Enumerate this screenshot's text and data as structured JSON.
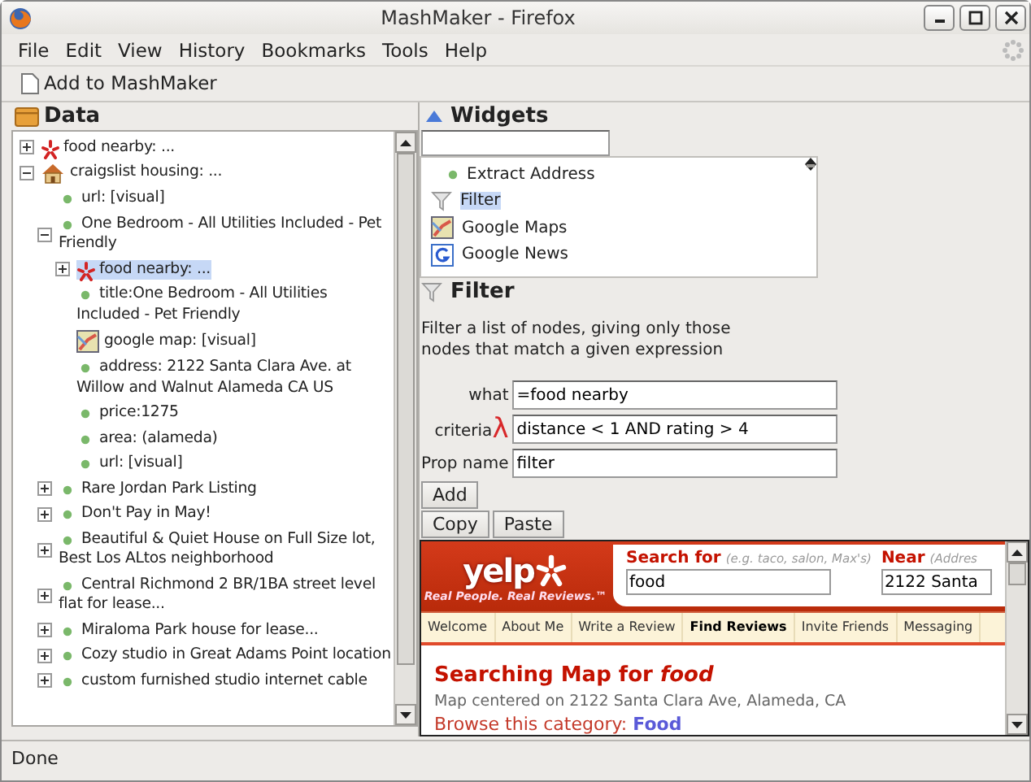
{
  "window": {
    "title": "MashMaker - Firefox"
  },
  "menu": [
    {
      "label": "File"
    },
    {
      "label": "Edit"
    },
    {
      "label": "View"
    },
    {
      "label": "History"
    },
    {
      "label": "Bookmarks"
    },
    {
      "label": "Tools"
    },
    {
      "label": "Help"
    }
  ],
  "toolbar": {
    "button": "Add to MashMaker"
  },
  "data_panel": {
    "title": "Data",
    "tree": [
      {
        "kind": "yelp",
        "label": "food nearby: ...",
        "expanded": false,
        "selected": false
      },
      {
        "kind": "house",
        "label": "craigslist housing: ...",
        "expanded": true,
        "selected": false,
        "children": [
          {
            "kind": "dot",
            "label": "url: [visual]",
            "selected": false
          },
          {
            "kind": "dot",
            "label": "One Bedroom - All Utilities Included - Pet Friendly",
            "expanded": true,
            "selected": false,
            "children": [
              {
                "kind": "yelp",
                "label": "food nearby: ...",
                "expanded": false,
                "selected": true
              },
              {
                "kind": "dot",
                "label": "title:One Bedroom - All Utilities Included - Pet Friendly",
                "selected": false
              },
              {
                "kind": "map",
                "label": "google map: [visual]",
                "selected": false
              },
              {
                "kind": "dot",
                "label": "address: 2122 Santa Clara Ave. at Willow and Walnut Alameda CA US",
                "selected": false
              },
              {
                "kind": "dot",
                "label": "price:1275",
                "selected": false
              },
              {
                "kind": "dot",
                "label": "area: (alameda)",
                "selected": false
              },
              {
                "kind": "dot",
                "label": "url: [visual]",
                "selected": false
              }
            ]
          },
          {
            "kind": "dot",
            "label": "Rare Jordan Park Listing",
            "expanded": false,
            "selected": false
          },
          {
            "kind": "dot",
            "label": "Don't Pay in May!",
            "expanded": false,
            "selected": false
          },
          {
            "kind": "dot",
            "label": "Beautiful & Quiet House on Full Size lot, Best Los ALtos neighborhood",
            "expanded": false,
            "selected": false
          },
          {
            "kind": "dot",
            "label": "Central Richmond 2 BR/1BA street level flat for lease...",
            "expanded": false,
            "selected": false
          },
          {
            "kind": "dot",
            "label": "Miraloma Park house for lease...",
            "expanded": false,
            "selected": false
          },
          {
            "kind": "dot",
            "label": "Cozy studio in Great Adams Point location",
            "expanded": false,
            "selected": false
          },
          {
            "kind": "dot",
            "label": "custom furnished studio internet cable",
            "expanded": false,
            "selected": false
          }
        ]
      }
    ]
  },
  "widgets_panel": {
    "title": "Widgets",
    "items": [
      {
        "kind": "dot",
        "label": "Extract Address",
        "selected": false
      },
      {
        "kind": "funnel",
        "label": "Filter",
        "selected": true
      },
      {
        "kind": "map",
        "label": "Google Maps",
        "selected": false
      },
      {
        "kind": "news",
        "label": "Google News",
        "selected": false
      }
    ]
  },
  "filter": {
    "title": "Filter",
    "description": "Filter a list of nodes, giving only those nodes that match a given expression",
    "fields": [
      {
        "label": "what",
        "value": "=food nearby"
      },
      {
        "label": "criteria",
        "icon_char": "λ",
        "value": "distance < 1 AND rating > 4"
      },
      {
        "label": "Prop name",
        "value": "filter"
      }
    ],
    "buttons": [
      "Add"
    ],
    "clipboard_buttons": [
      "Copy",
      "Paste"
    ]
  },
  "web_frame": {
    "logo": "yelp",
    "tagline": "Real People. Real Reviews.™",
    "search_label": "Search for",
    "search_hint": "(e.g. taco, salon, Max's)",
    "search_value": "food",
    "near_label": "Near",
    "near_hint": "(Addres",
    "near_value": "2122 Santa",
    "nav": [
      {
        "label": "Welcome",
        "selected": false
      },
      {
        "label": "About Me",
        "selected": false
      },
      {
        "label": "Write a Review",
        "selected": false
      },
      {
        "label": "Find Reviews",
        "selected": true
      },
      {
        "label": "Invite Friends",
        "selected": false
      },
      {
        "label": "Messaging",
        "selected": false
      }
    ],
    "heading": "Searching Map for *food*",
    "subtitle": "Map centered on 2122 Santa Clara Ave, Alameda, CA",
    "browse_label": "Browse this category:",
    "browse_link": "Food"
  },
  "status_bar": {
    "text": "Done"
  }
}
